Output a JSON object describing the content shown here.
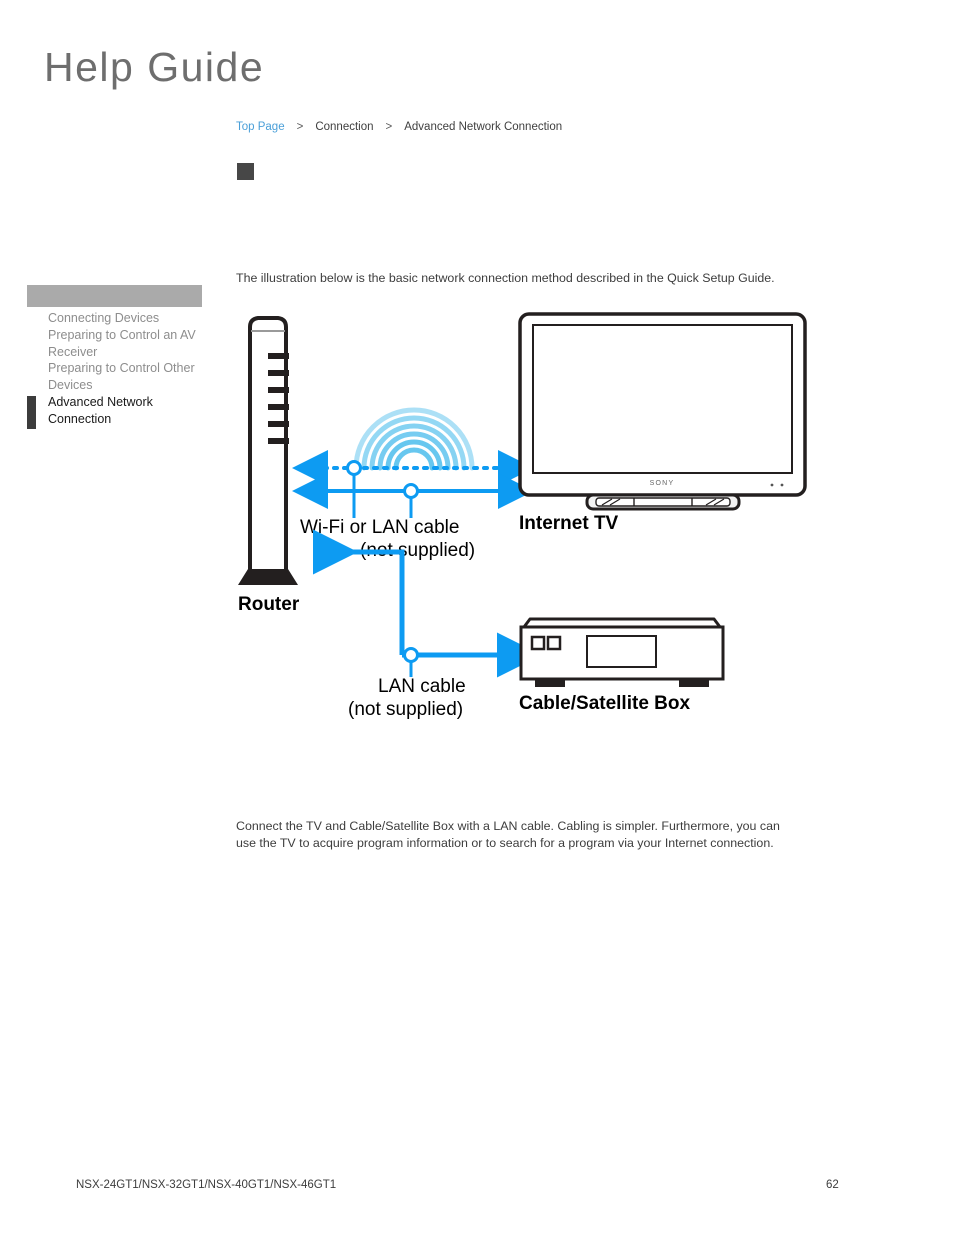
{
  "header": {
    "logo_text": "Help Guide"
  },
  "breadcrumb": {
    "items": [
      {
        "label": "Top Page",
        "type": "link"
      },
      {
        "label": "Connection",
        "type": "text"
      },
      {
        "label": "Advanced Network Connection",
        "type": "text"
      }
    ],
    "separator": ">"
  },
  "sidebar": {
    "items": [
      {
        "label": "Connecting Devices",
        "active": false
      },
      {
        "label": "Preparing to Control an AV Receiver",
        "active": false
      },
      {
        "label": "Preparing to Control Other Devices",
        "active": false
      },
      {
        "label": "Advanced Network Connection",
        "active": true
      }
    ]
  },
  "main": {
    "intro_paragraph": "The illustration below is the basic network connection method described in the Quick Setup Guide.",
    "outro_paragraph": "Connect the TV and Cable/Satellite Box with a LAN cable. Cabling is simpler. Furthermore, you can use the TV to acquire program information or to search for a program via your Internet connection."
  },
  "diagram": {
    "labels": {
      "router": "Router",
      "wifi_or_lan": "Wi-Fi or LAN cable",
      "wifi_or_lan_note": "(not supplied)",
      "internet_tv": "Internet TV",
      "lan_cable": "LAN cable",
      "lan_cable_note": "(not supplied)",
      "cable_satellite_box": "Cable/Satellite Box",
      "tv_brand": "SONY"
    },
    "colors": {
      "arrow_blue": "#0d9bf2",
      "wifi_arc_blue": "#67c7ef",
      "outline_black": "#231f1f"
    }
  },
  "footer": {
    "model_numbers": "NSX-24GT1/NSX-32GT1/NSX-40GT1/NSX-46GT1",
    "page_number": "62"
  }
}
